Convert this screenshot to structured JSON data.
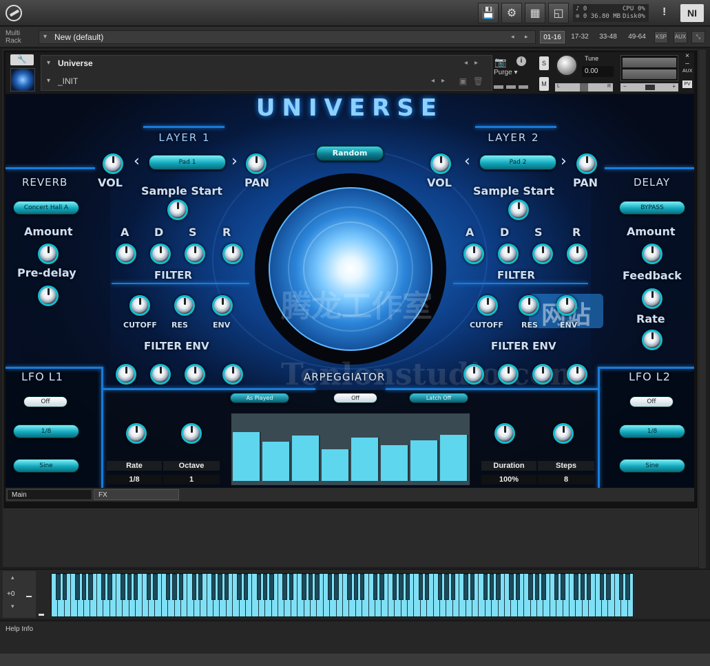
{
  "topbar": {
    "stats": {
      "voices": "0",
      "memory_voices": "0",
      "memory": "36.80 MB",
      "cpu_label": "CPU",
      "cpu": "0%",
      "disk_label": "Disk",
      "disk": "0%"
    },
    "alert": "!",
    "ni_logo": "NI"
  },
  "rack": {
    "label_line1": "Multi",
    "label_line2": "Rack",
    "multi_name": "New (default)",
    "page_tabs": [
      "01-16",
      "17-32",
      "33-48",
      "49-64"
    ],
    "active_tab": "01-16",
    "ksp": "KSP",
    "aux": "AUX"
  },
  "instrument": {
    "name": "Universe",
    "snapshot": "_INIT",
    "purge": "Purge",
    "solo": "S",
    "mute": "M",
    "tune_label": "Tune",
    "tune_value": "0.00",
    "pan_left": "L",
    "pan_right": "R",
    "aux": "AUX",
    "pv": "PV"
  },
  "panel": {
    "title": "UNIVERSE",
    "layer1": "LAYER 1",
    "layer2": "LAYER 2",
    "random": "Random",
    "vol": "VOL",
    "pan": "PAN",
    "pad1": "Pad 1",
    "pad2": "Pad 2",
    "sample_start": "Sample Start",
    "adsr": [
      "A",
      "D",
      "S",
      "R"
    ],
    "filter": "FILTER",
    "cutoff": "CUTOFF",
    "res": "RES",
    "env": "ENV",
    "filter_env": "FILTER ENV",
    "reverb": "REVERB",
    "reverb_type": "Concert Hall A",
    "amount": "Amount",
    "predelay": "Pre-delay",
    "delay": "DELAY",
    "delay_type": "BYPASS",
    "feedback": "Feedback",
    "rate": "Rate",
    "lfo1": "LFO  L1",
    "lfo2": "LFO  L2",
    "lfo_state": "Off",
    "lfo_rate": "1/8",
    "lfo_shape": "Sine",
    "arpeggiator": "ARPEGGIATOR",
    "arp_mode": "As Played",
    "arp_state": "Off",
    "arp_latch": "Latch Off",
    "arp_table_left": {
      "headers": [
        "Rate",
        "Octave"
      ],
      "values": [
        "1/8",
        "1"
      ]
    },
    "arp_table_right": {
      "headers": [
        "Duration",
        "Steps"
      ],
      "values": [
        "100%",
        "8"
      ]
    },
    "arp_steps": [
      0.77,
      0.62,
      0.72,
      0.5,
      0.68,
      0.57,
      0.64,
      0.73
    ]
  },
  "watermark": {
    "cn": "腾龙工作室",
    "cn2": "网站",
    "en": "Tenlonstudio.com"
  },
  "bottom_tabs": {
    "main": "Main",
    "fx": "FX"
  },
  "keyboard": {
    "octave": "+0"
  },
  "help": "Help Info"
}
